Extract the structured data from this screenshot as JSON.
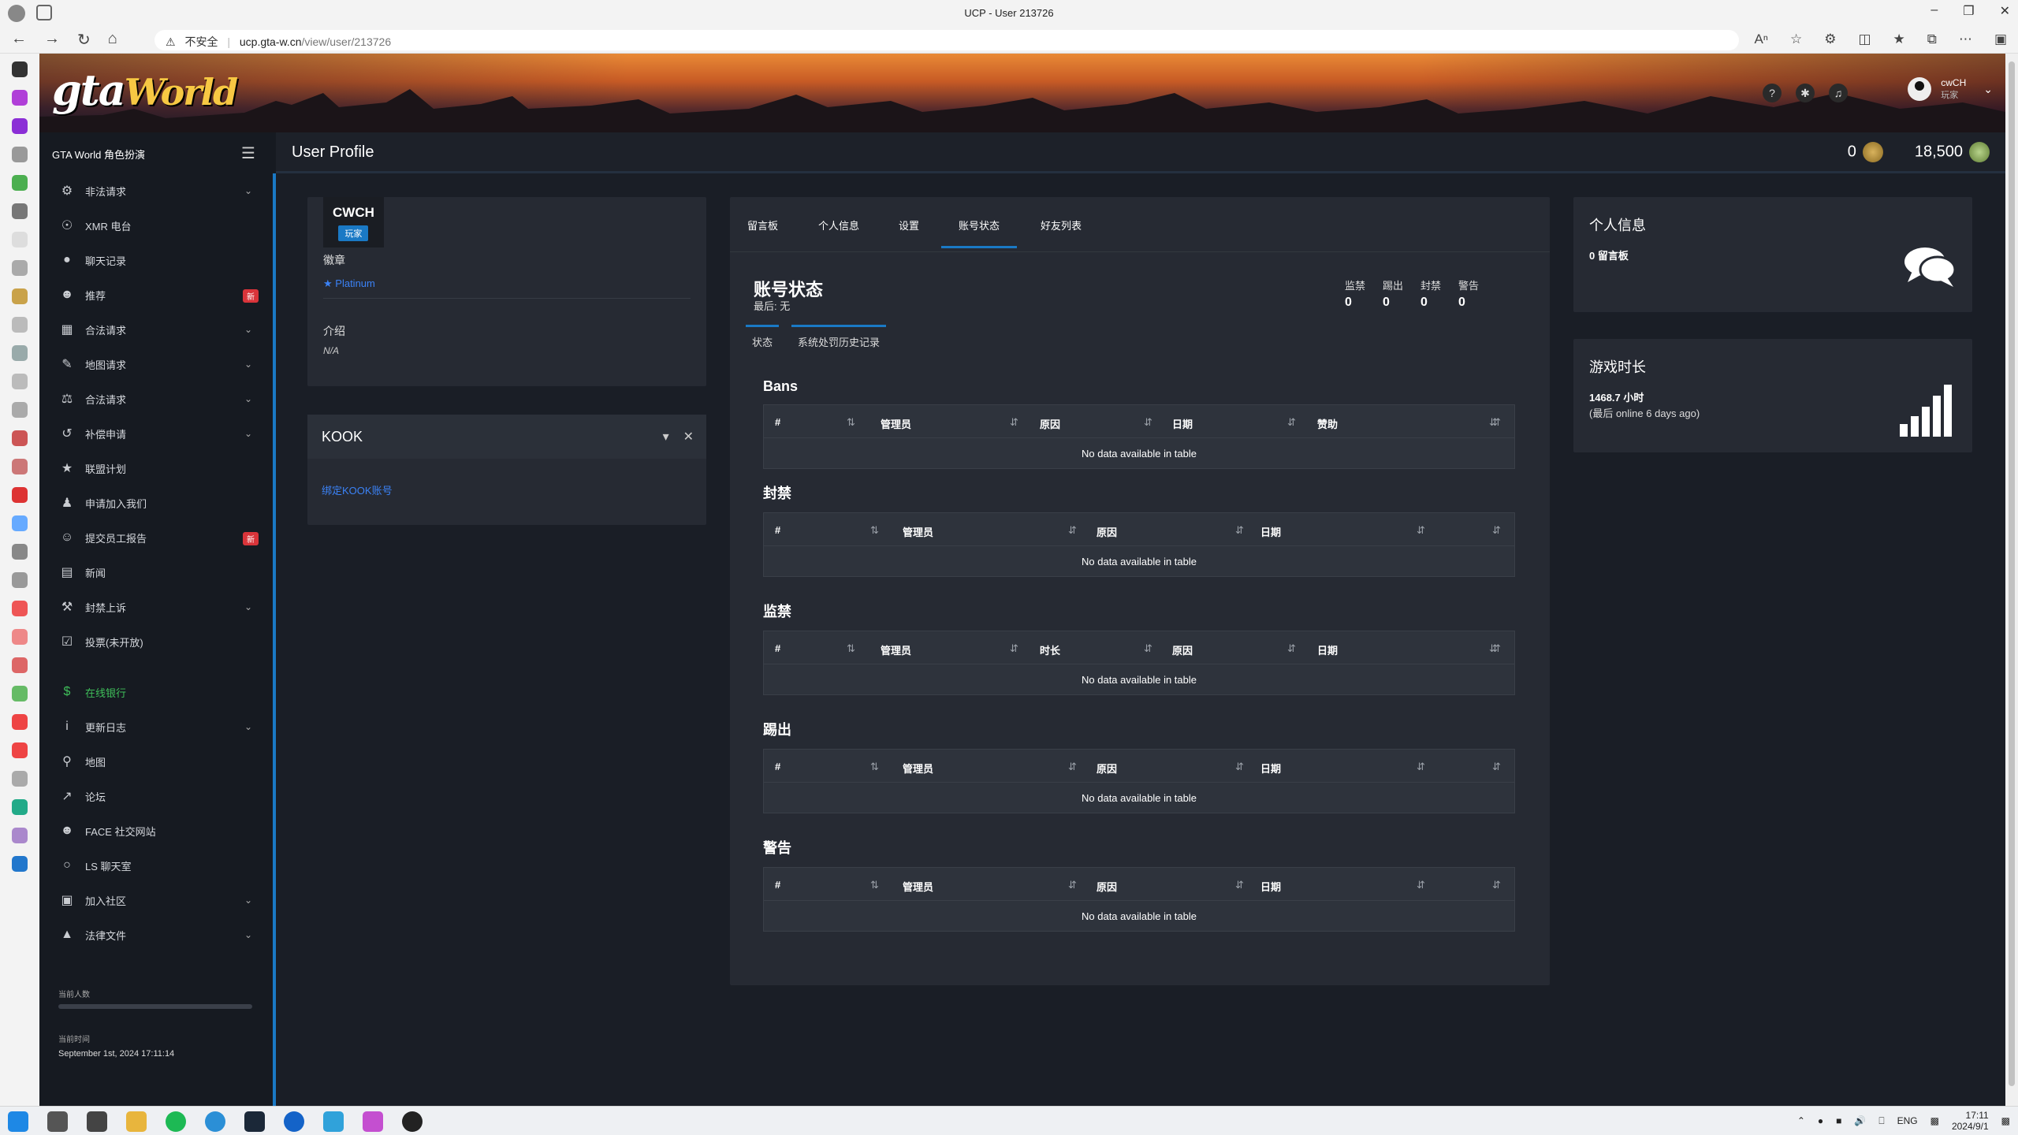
{
  "browser": {
    "window_title": "UCP - User 213726",
    "url_warning": "不安全",
    "url_host": "ucp.gta-w.cn",
    "url_path": "/view/user/213726"
  },
  "header": {
    "brand": "GTA World 角色扮演",
    "page_title": "User Profile",
    "user_name": "cwCH",
    "user_role": "玩家",
    "currency_gold": "0",
    "currency_green": "18,500"
  },
  "nav": {
    "items": [
      {
        "label": "非法请求",
        "icon": "controller-icon",
        "arrow": "⌄"
      },
      {
        "label": "XMR 电台",
        "icon": "radio-icon"
      },
      {
        "label": "聊天记录",
        "icon": "chat-icon"
      },
      {
        "label": "推荐",
        "icon": "users-icon",
        "badge": "新"
      },
      {
        "label": "合法请求",
        "icon": "building-icon",
        "arrow": "⌄"
      },
      {
        "label": "地图请求",
        "icon": "brush-icon",
        "arrow": "⌄"
      },
      {
        "label": "合法请求",
        "icon": "scale-icon",
        "arrow": "⌄"
      },
      {
        "label": "补偿申请",
        "icon": "undo-icon",
        "arrow": "⌄"
      },
      {
        "label": "联盟计划",
        "icon": "star-icon"
      },
      {
        "label": "申请加入我们",
        "icon": "user-icon"
      },
      {
        "label": "提交员工报告",
        "icon": "face-icon",
        "badge": "新"
      },
      {
        "label": "新闻",
        "icon": "newspaper-icon"
      },
      {
        "label": "封禁上诉",
        "icon": "gavel-icon",
        "arrow": "⌄"
      },
      {
        "label": "投票(未开放)",
        "icon": "vote-icon"
      }
    ],
    "items2": [
      {
        "label": "在线银行",
        "icon": "dollar-icon"
      },
      {
        "label": "更新日志",
        "icon": "info-icon",
        "arrow": "⌄"
      },
      {
        "label": "地图",
        "icon": "map-pin-icon"
      },
      {
        "label": "论坛",
        "icon": "external-link-icon"
      },
      {
        "label": "FACE 社交网站",
        "icon": "users-icon"
      },
      {
        "label": "LS 聊天室",
        "icon": "comments-icon"
      },
      {
        "label": "加入社区",
        "icon": "community-icon",
        "arrow": "⌄"
      },
      {
        "label": "法律文件",
        "icon": "lock-icon",
        "arrow": "⌄"
      }
    ],
    "players_label": "当前人数",
    "time_label": "当前时间",
    "time_value": "September 1st, 2024 17:11:14"
  },
  "profile": {
    "name": "CWCH",
    "role": "玩家",
    "badge_label": "徽章",
    "badge_value": "Platinum",
    "intro_label": "介绍",
    "intro_value": "N/A"
  },
  "kook": {
    "title": "KOOK",
    "link": "绑定KOOK账号"
  },
  "center": {
    "tabs": [
      "留言板",
      "个人信息",
      "设置",
      "账号状态",
      "好友列表"
    ],
    "section_title": "账号状态",
    "section_sub": "最后: 无",
    "stats": [
      {
        "label": "监禁",
        "value": "0"
      },
      {
        "label": "踢出",
        "value": "0"
      },
      {
        "label": "封禁",
        "value": "0"
      },
      {
        "label": "警告",
        "value": "0"
      }
    ],
    "subtabs": [
      "状态",
      "系统处罚历史记录"
    ],
    "empty_text": "No data available in table",
    "tables": [
      {
        "title": "Bans",
        "cols": [
          "#",
          "管理员",
          "原因",
          "日期",
          "赞助"
        ]
      },
      {
        "title": "封禁",
        "cols": [
          "#",
          "管理员",
          "原因",
          "日期"
        ]
      },
      {
        "title": "监禁",
        "cols": [
          "#",
          "管理员",
          "时长",
          "原因",
          "日期"
        ]
      },
      {
        "title": "踢出",
        "cols": [
          "#",
          "管理员",
          "原因",
          "日期"
        ]
      },
      {
        "title": "警告",
        "cols": [
          "#",
          "管理员",
          "原因",
          "日期"
        ]
      }
    ]
  },
  "right": {
    "info_title": "个人信息",
    "info_text": "0 留言板",
    "time_title": "游戏时长",
    "time_hours": "1468.7 小时",
    "time_last": "(最后 online 6 days ago)"
  },
  "taskbar": {
    "lang": "ENG",
    "time": "17:11",
    "date": "2024/9/1"
  }
}
